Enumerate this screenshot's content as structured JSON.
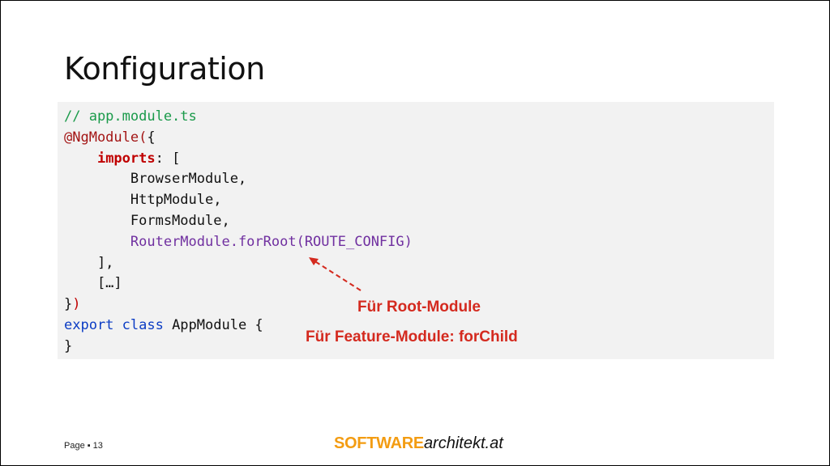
{
  "slide": {
    "title": "Konfiguration",
    "code_lines": [
      [
        {
          "t": "// app.module.ts",
          "c": "c-comment"
        }
      ],
      [
        {
          "t": "@NgModule(",
          "c": "c-dec"
        },
        {
          "t": "{",
          "c": ""
        }
      ],
      [
        {
          "t": "    ",
          "c": ""
        },
        {
          "t": "imports",
          "c": "c-key"
        },
        {
          "t": ": [",
          "c": ""
        }
      ],
      [
        {
          "t": "        BrowserModule,",
          "c": ""
        }
      ],
      [
        {
          "t": "        HttpModule,",
          "c": ""
        }
      ],
      [
        {
          "t": "        FormsModule,",
          "c": ""
        }
      ],
      [
        {
          "t": "        ",
          "c": ""
        },
        {
          "t": "RouterModule.forRoot(ROUTE_CONFIG)",
          "c": "c-purple"
        }
      ],
      [
        {
          "t": "    ],",
          "c": ""
        }
      ],
      [
        {
          "t": "    […]",
          "c": ""
        }
      ],
      [
        {
          "t": "}",
          "c": ""
        },
        {
          "t": ")",
          "c": "c-red"
        }
      ],
      [
        {
          "t": "export class",
          "c": "c-blue"
        },
        {
          "t": " AppModule {",
          "c": ""
        }
      ],
      [
        {
          "t": "}",
          "c": ""
        }
      ]
    ],
    "annotations": {
      "root": "Für Root-Module",
      "feature": "Für Feature-Module: forChild"
    },
    "footer": {
      "page_label": "Page",
      "separator": "▪",
      "page_number": "13",
      "logo_bold": "SOFTWARE",
      "logo_italic": "architekt.at"
    },
    "colors": {
      "annotation": "#d42a1f",
      "logo_accent": "#f39c12",
      "code_background": "#f2f2f2"
    }
  }
}
